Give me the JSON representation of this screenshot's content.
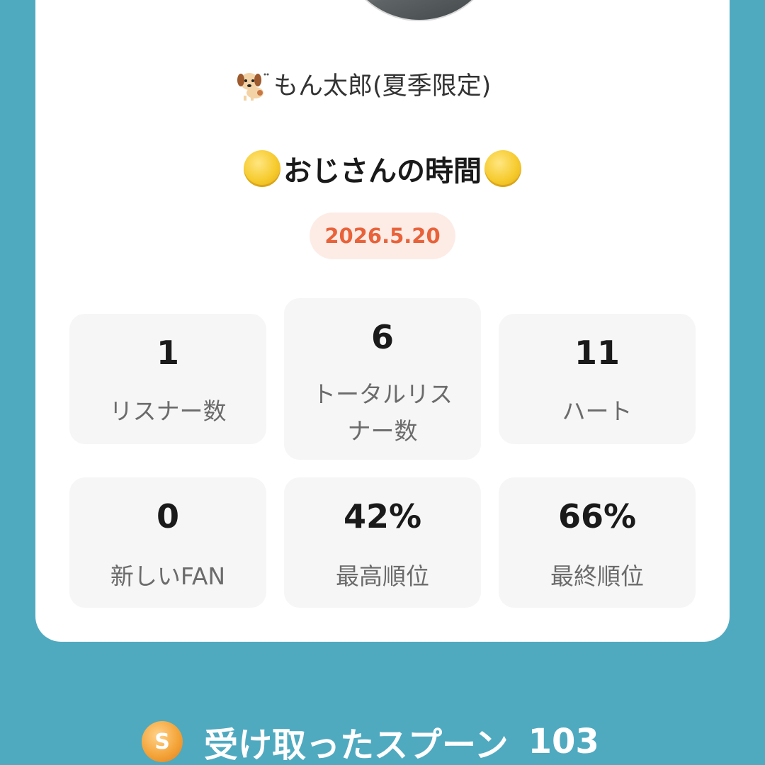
{
  "profile": {
    "avatar_icon": "dog-photo",
    "username": "もん太郎(夏季限定)",
    "username_icon": "dog-emoji-icon"
  },
  "broadcast": {
    "title": "おじさんの時間",
    "title_icon": "yellow-circle-icon",
    "date": "2026.5.20"
  },
  "stats": [
    {
      "value": "1",
      "label": "リスナー数"
    },
    {
      "value": "6",
      "label_line1": "トータルリス",
      "label_line2": "ナー数"
    },
    {
      "value": "11",
      "label": "ハート"
    },
    {
      "value": "0",
      "label": "新しいFAN"
    },
    {
      "value": "42%",
      "label": "最高順位"
    },
    {
      "value": "66%",
      "label": "最終順位"
    }
  ],
  "spoons": {
    "icon": "spoon-coin-icon",
    "icon_letter": "S",
    "label": "受け取ったスプーン",
    "count": "103"
  },
  "colors": {
    "background": "#4faac0",
    "card": "#ffffff",
    "date_text": "#e8623a",
    "date_pill": "#fdece6",
    "stat_tile": "#f6f6f6"
  }
}
